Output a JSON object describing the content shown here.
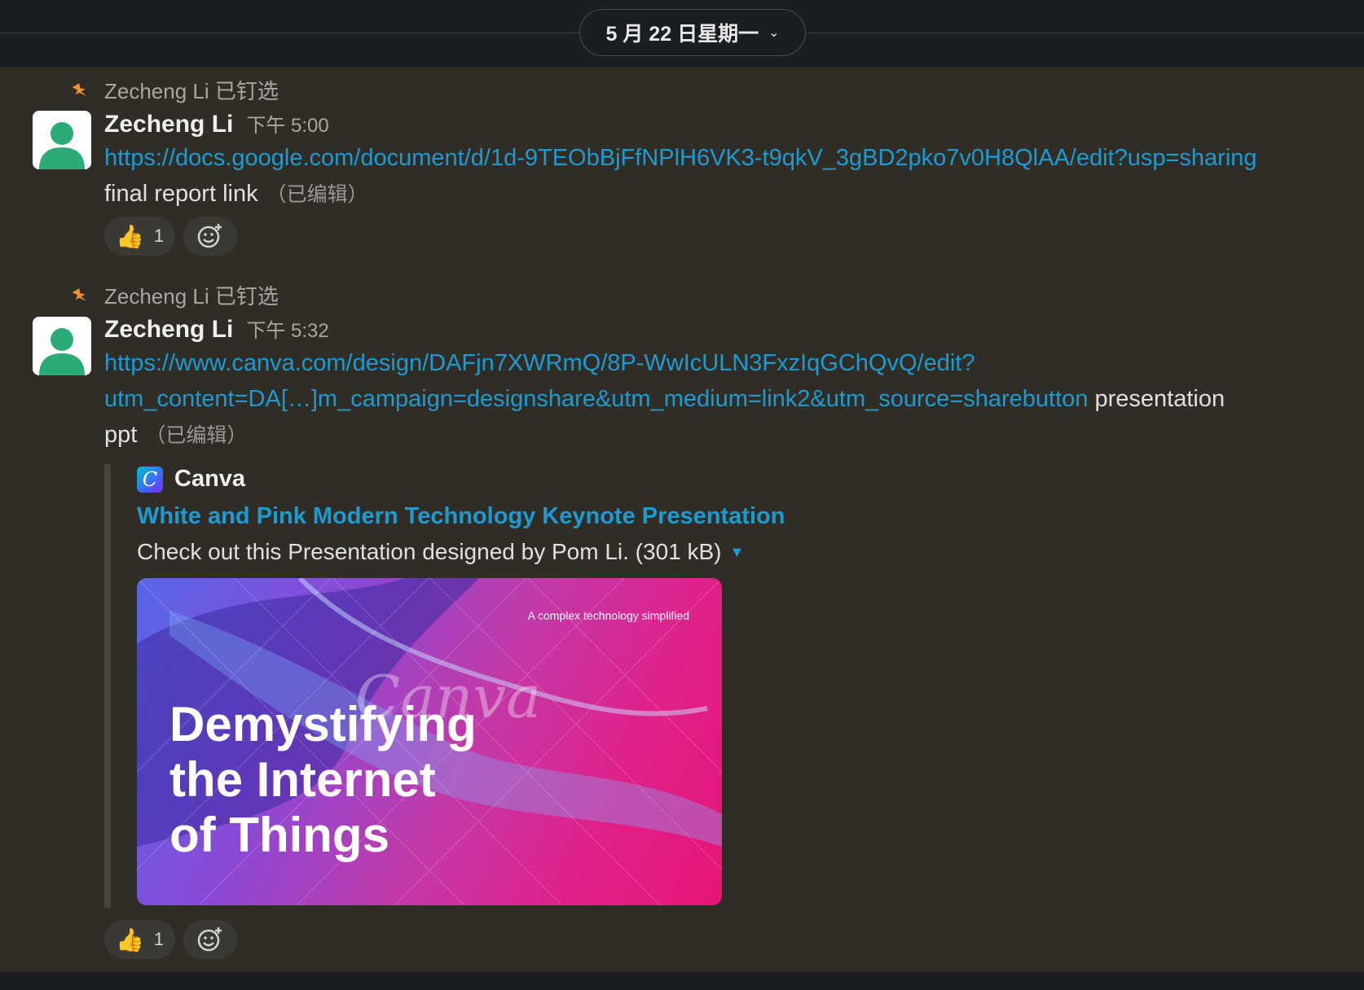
{
  "date_divider": {
    "label": "5 月 22 日星期一",
    "chevron": "chevron-down-icon"
  },
  "messages": [
    {
      "pinned_by": "Zecheng Li 已钉选",
      "author": "Zecheng Li",
      "time": "下午 5:00",
      "link": "https://docs.google.com/document/d/1d-9TEObBjFfNPlH6VK3-t9qkV_3gBD2pko7v0H8QlAA/edit?usp=sharing",
      "text": "final report link",
      "edited": "（已编辑）",
      "reaction": {
        "emoji": "👍",
        "count": "1"
      }
    },
    {
      "pinned_by": "Zecheng Li 已钉选",
      "author": "Zecheng Li",
      "time": "下午 5:32",
      "link_line1": "https://www.canva.com/design/DAFjn7XWRmQ/8P-WwIcULN3FxzIqGChQvQ/edit?",
      "link_line2": "utm_content=DA[…]m_campaign=designshare&utm_medium=link2&utm_source=sharebutton",
      "text_tail": " presentation",
      "text_line3": "ppt",
      "edited": "（已编辑）",
      "unfurl": {
        "source": "Canva",
        "source_icon_letter": "C",
        "title": "White and Pink Modern Technology Keynote Presentation",
        "description": "Check out this Presentation designed by Pom Li. (301 kB)",
        "thumb_tagline": "A complex technology simplified",
        "thumb_title": "Demystifying\nthe Internet\nof Things",
        "thumb_watermark": "Canva"
      },
      "reaction": {
        "emoji": "👍",
        "count": "1"
      }
    }
  ],
  "colors": {
    "link": "#1d9bd1",
    "pin": "#e8912d",
    "avatar_green": "#2bac76",
    "feed_bg": "#302d27"
  }
}
